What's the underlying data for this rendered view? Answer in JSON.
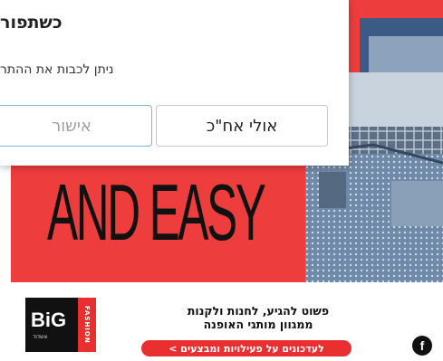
{
  "dialog": {
    "title": "כשתפור",
    "body": "ניתן לכבות את ההתר",
    "approve_label": "אישור",
    "later_label": "אולי אח\"כ"
  },
  "ad": {
    "headline": "AND EASY",
    "tagline_line1": "פשוט להגיע, לחנות ולקנות",
    "tagline_line2": "ממגוון מותגי האופנה",
    "cta_label": "לעדכונים על פעילויות ומבצעים >",
    "brand_name": "BiG",
    "brand_sub": "FASHION",
    "brand_small": "אשדוד",
    "social_icon": "facebook-icon",
    "colors": {
      "banner": "#ee3d3d",
      "cta": "#e92f2f"
    }
  }
}
